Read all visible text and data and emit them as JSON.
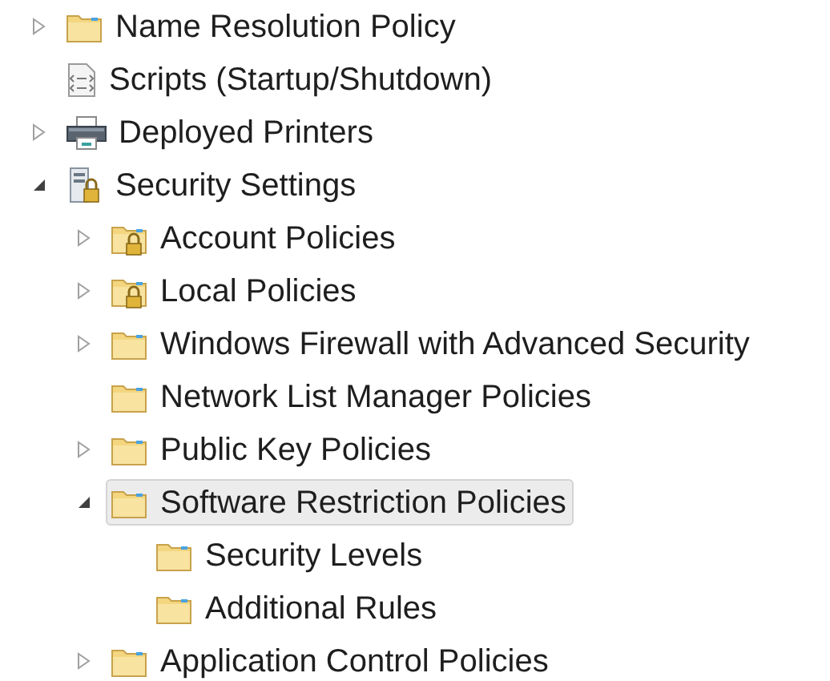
{
  "tree": [
    {
      "label": "Name Resolution Policy",
      "kind": "folder",
      "expanded": false,
      "selected": false
    },
    {
      "label": "Scripts (Startup/Shutdown)",
      "kind": "script",
      "selected": false
    },
    {
      "label": "Deployed Printers",
      "kind": "printer",
      "expanded": false,
      "selected": false
    },
    {
      "label": "Security Settings",
      "kind": "security",
      "expanded": true,
      "selected": false,
      "children": [
        {
          "label": "Account Policies",
          "kind": "locked",
          "expanded": false,
          "selected": false
        },
        {
          "label": "Local Policies",
          "kind": "locked",
          "expanded": false,
          "selected": false
        },
        {
          "label": "Windows Firewall with Advanced Security",
          "kind": "folder",
          "expanded": false,
          "selected": false
        },
        {
          "label": "Network List Manager Policies",
          "kind": "folder",
          "selected": false
        },
        {
          "label": "Public Key Policies",
          "kind": "folder",
          "expanded": false,
          "selected": false
        },
        {
          "label": "Software Restriction Policies",
          "kind": "folder",
          "expanded": true,
          "selected": true,
          "children": [
            {
              "label": "Security Levels",
              "kind": "folder",
              "selected": false
            },
            {
              "label": "Additional Rules",
              "kind": "folder",
              "selected": false
            }
          ]
        },
        {
          "label": "Application Control Policies",
          "kind": "folder",
          "expanded": false,
          "selected": false
        }
      ]
    }
  ]
}
